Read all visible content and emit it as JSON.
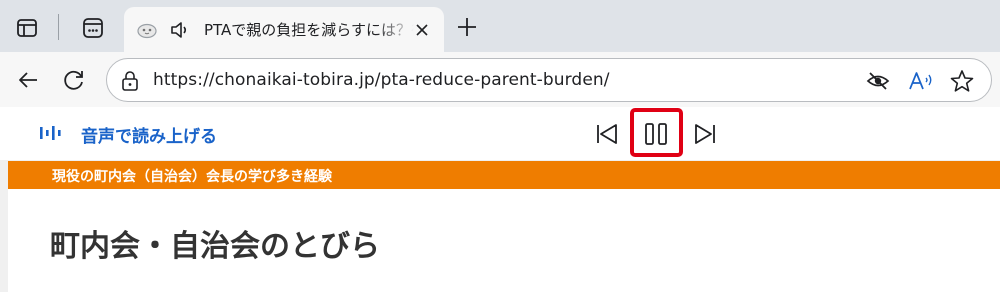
{
  "tab": {
    "title": "PTAで親の負担を減らすには？役員の負担を減らす工夫",
    "close_label": "×"
  },
  "address_bar": {
    "url": "https://chonaikai-tobira.jp/pta-reduce-parent-burden/"
  },
  "read_aloud": {
    "label": "音声で読み上げる"
  },
  "site": {
    "banner": "現役の町内会（自治会）会長の学び多き経験",
    "title": "町内会・自治会のとびら"
  },
  "colors": {
    "accent_blue": "#1a63c9",
    "banner_orange": "#ef7d00",
    "highlight_red": "#e00014"
  },
  "icons": [
    "sidebar-layout-icon",
    "tab-actions-icon",
    "site-favicon-icon",
    "speaker-icon",
    "close-icon",
    "plus-icon",
    "back-arrow-icon",
    "refresh-icon",
    "lock-icon",
    "tracking-prevention-icon",
    "read-aloud-icon",
    "favorite-star-icon",
    "audio-waveform-icon",
    "skip-previous-icon",
    "pause-icon",
    "skip-next-icon"
  ]
}
